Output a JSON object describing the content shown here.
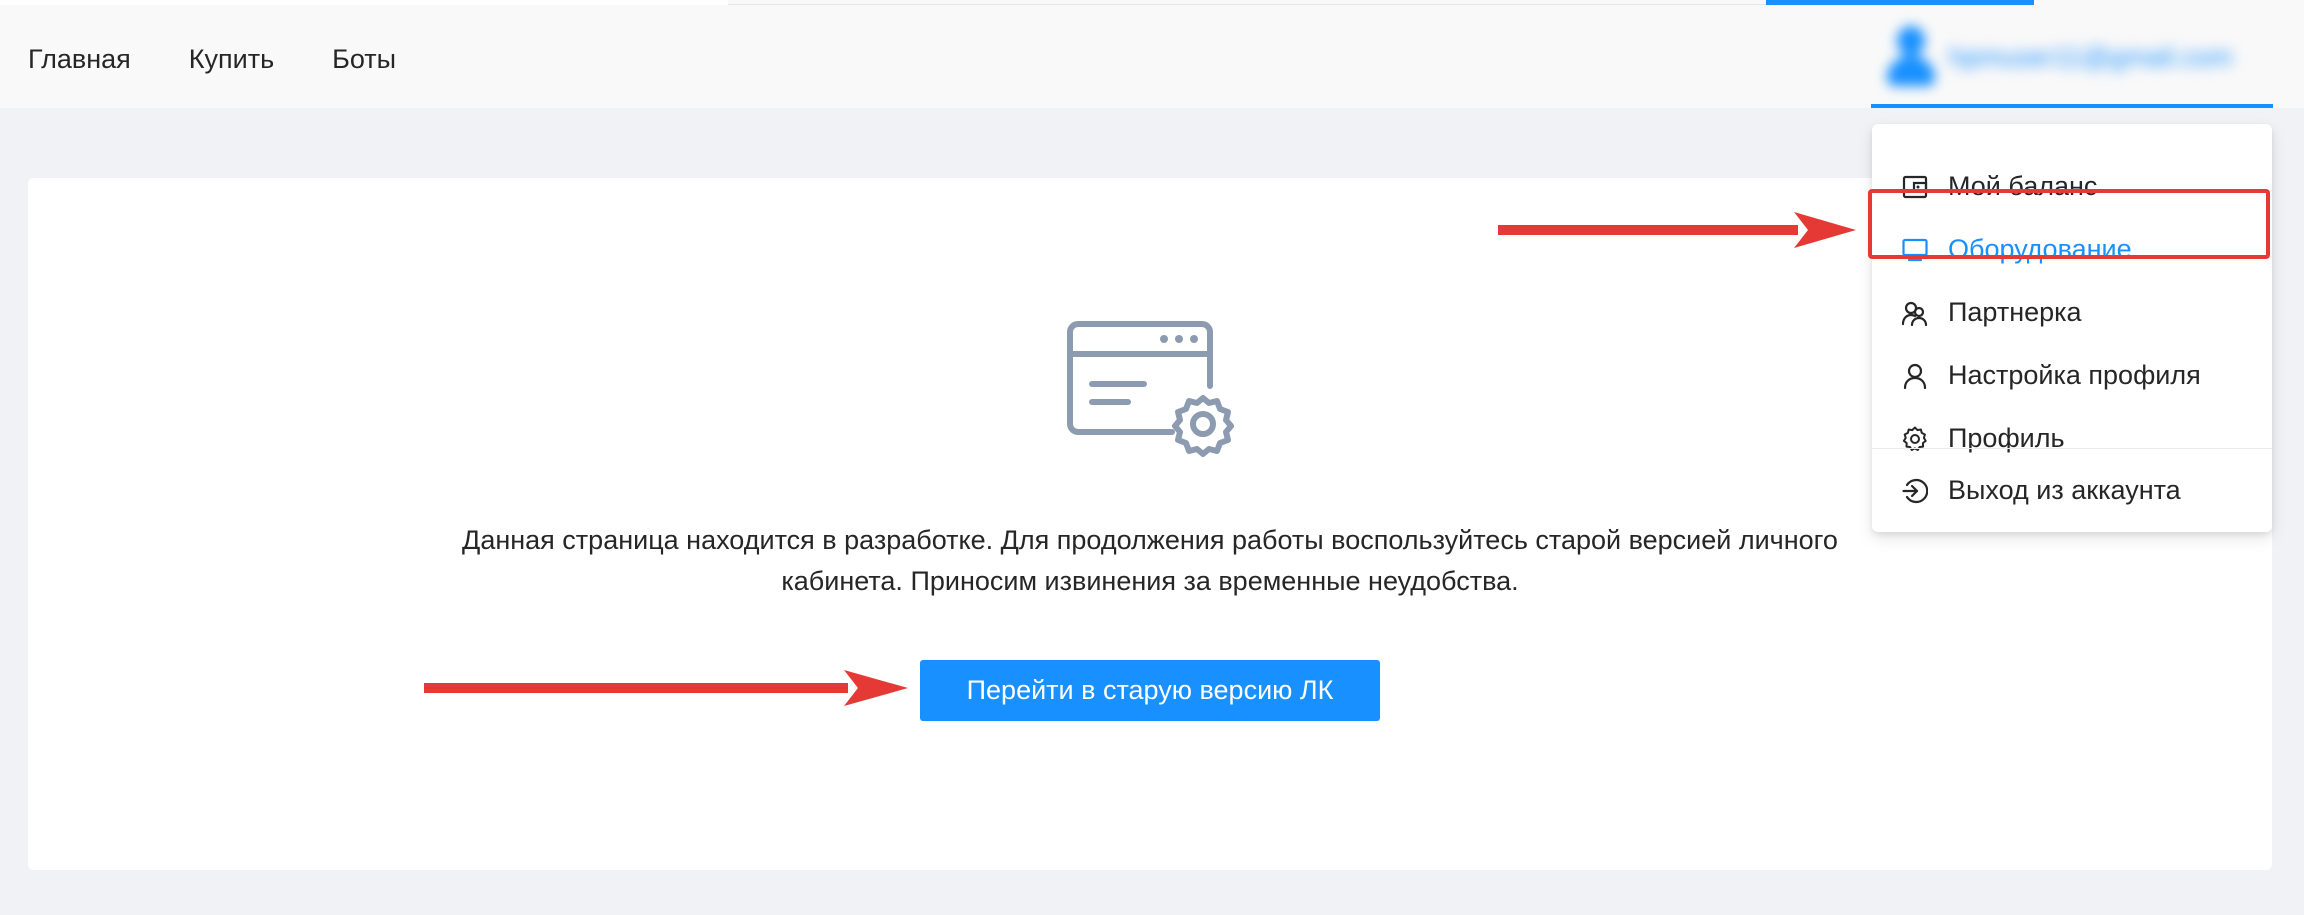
{
  "nav": {
    "items": [
      {
        "label": "Главная"
      },
      {
        "label": "Купить"
      },
      {
        "label": "Боты"
      }
    ]
  },
  "user": {
    "email": "hpmuser11@gmail.com"
  },
  "dropdown": {
    "items": [
      {
        "label": "Мой баланс",
        "icon": "wallet-icon"
      },
      {
        "label": "Оборудование",
        "icon": "monitor-icon",
        "active": true
      },
      {
        "label": "Партнерка",
        "icon": "partners-icon"
      },
      {
        "label": "Настройка профиля",
        "icon": "user-icon"
      },
      {
        "label": "Профиль",
        "icon": "gear-icon"
      }
    ],
    "logout_label": "Выход из аккаунта",
    "logout_icon": "logout-icon"
  },
  "main": {
    "message_line1": "Данная страница находится в разработке. Для продолжения работы воспользуйтесь старой версией личного",
    "message_line2": "кабинета. Приносим извинения за временные неудобства.",
    "button_label": "Перейти в старую версию ЛК",
    "illustration": "browser-settings-icon"
  },
  "colors": {
    "accent": "#1890ff",
    "annotation": "#e53935",
    "background": "#f0f2f5",
    "icon_gray": "#8c9bb0"
  }
}
